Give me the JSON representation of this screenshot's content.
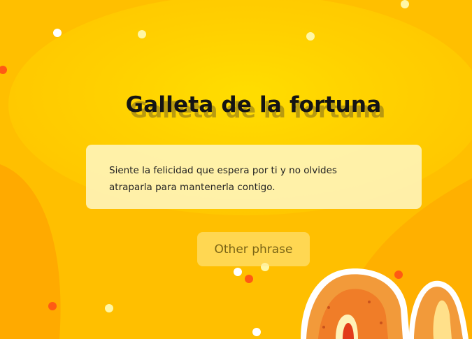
{
  "app": {
    "title": "Galleta de la fortuna",
    "phrase": "Siente la felicidad que espera por ti y no olvides atraparla para mantenerla contigo.",
    "button_label": "Other phrase"
  },
  "colors": {
    "background": "#ffbf00",
    "glow": "#ffd100",
    "card": "#fff8cc",
    "button": "#ffec9b",
    "cookie": "#f29a3a",
    "confetti_white": "#ffffff",
    "confetti_orange": "#ff5a14"
  },
  "icons": {
    "fortune_cookie": "fortune-cookie-icon"
  }
}
